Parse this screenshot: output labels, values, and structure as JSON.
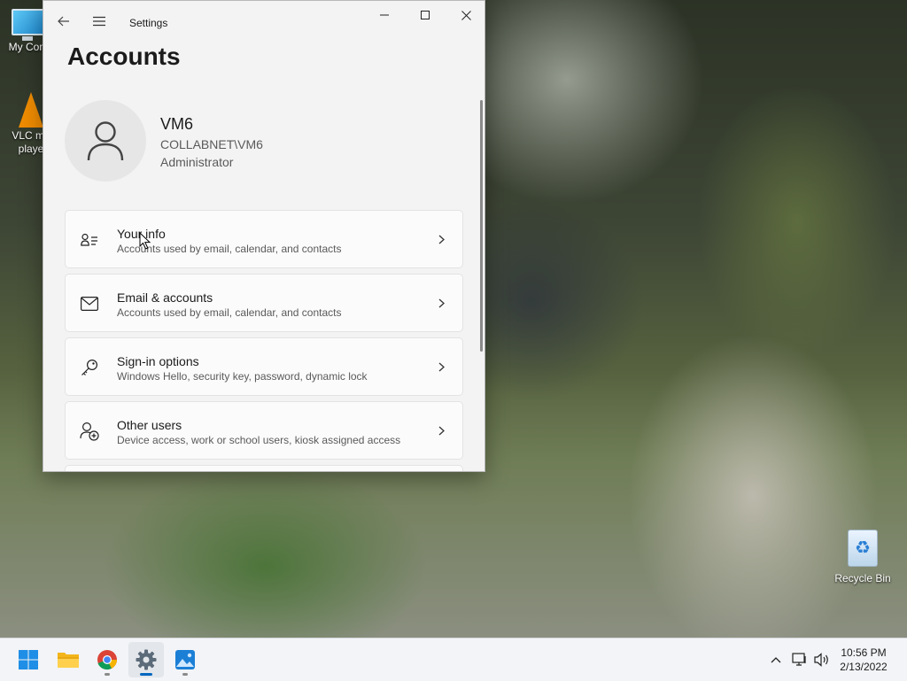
{
  "desktop": {
    "icons": [
      {
        "label": "My Com"
      },
      {
        "label_line1": "VLC me",
        "label_line2": "playe"
      },
      {
        "label": "Recycle Bin"
      }
    ]
  },
  "window": {
    "app_title": "Settings",
    "page_title": "Accounts"
  },
  "profile": {
    "name": "VM6",
    "domain": "COLLABNET\\VM6",
    "role": "Administrator"
  },
  "cards": [
    {
      "title": "Your info",
      "desc": "Accounts used by email, calendar, and contacts",
      "icon": "contact-card-icon"
    },
    {
      "title": "Email & accounts",
      "desc": "Accounts used by email, calendar, and contacts",
      "icon": "mail-icon"
    },
    {
      "title": "Sign-in options",
      "desc": "Windows Hello, security key, password, dynamic lock",
      "icon": "key-icon"
    },
    {
      "title": "Other users",
      "desc": "Device access, work or school users, kiosk assigned access",
      "icon": "add-user-icon"
    }
  ],
  "taskbar": {
    "apps": [
      "start-icon",
      "file-explorer-icon",
      "chrome-icon",
      "settings-icon",
      "photos-icon"
    ],
    "time": "10:56 PM",
    "date": "2/13/2022"
  },
  "colors": {
    "accent": "#0067c0",
    "window_bg": "#f3f3f3",
    "card_bg": "#fbfbfb"
  }
}
